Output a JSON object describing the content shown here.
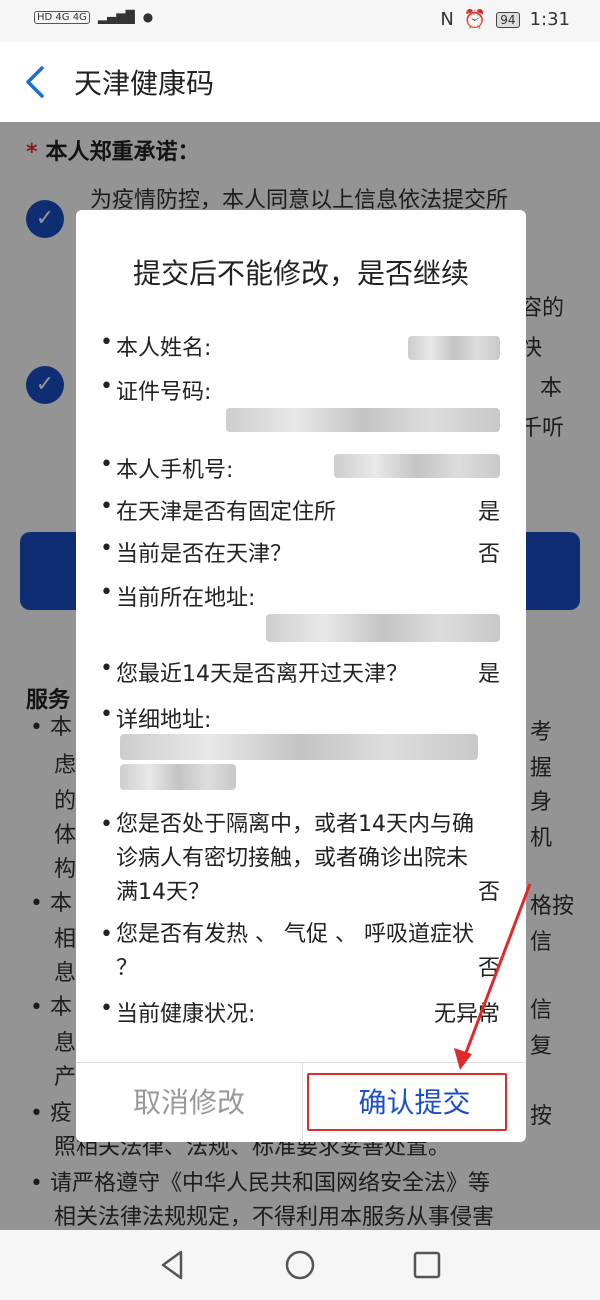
{
  "status_bar": {
    "left_indicators": "HD 4G 4G",
    "battery": "94",
    "time": "1:31"
  },
  "header": {
    "title": "天津健康码"
  },
  "background": {
    "pledge_title": "本人郑重承诺：",
    "pledge_item_1": "为疫情防控，本人同意以上信息依法提交所",
    "pledge_item_2_fragments": [
      "容的",
      "快",
      "本",
      "千听"
    ],
    "service_title": "服务",
    "service_lines": [
      "• 本",
      "虑",
      "的",
      "体",
      "构",
      "• 本",
      "相",
      "息",
      "• 本",
      "息",
      "产",
      "• 疫",
      "照相关法律、法规、标准要求妥善处置。",
      "• 请严格遵守《中华人民共和国网络安全法》等",
      "相关法律法规规定，不得利用本服务从事侵害"
    ],
    "right_fragments": [
      "考",
      "握",
      "身",
      "机",
      "格按",
      "信",
      "信",
      "复",
      "按"
    ]
  },
  "dialog": {
    "title": "提交后不能修改，是否继续",
    "rows": [
      {
        "label": "本人姓名:",
        "value": ""
      },
      {
        "label": "证件号码:",
        "value": ""
      },
      {
        "label": "本人手机号:",
        "value": ""
      },
      {
        "label": "在天津是否有固定住所",
        "value": "是"
      },
      {
        "label": "当前是否在天津？",
        "value": "否"
      },
      {
        "label": "当前所在地址:",
        "value": ""
      },
      {
        "label": "您最近14天是否离开过天津？",
        "value": "是"
      },
      {
        "label": "详细地址:",
        "value": ""
      },
      {
        "label": "您是否处于隔离中，或者14天内与确诊病人有密切接触，或者确诊出院未满14天？",
        "value": "否"
      },
      {
        "label": "您是否有发热 、 气促 、 呼吸道症状 ？",
        "value": "否"
      },
      {
        "label": "当前健康状况:",
        "value": "无异常"
      }
    ],
    "cancel_label": "取消修改",
    "confirm_label": "确认提交"
  },
  "colors": {
    "accent": "#1a4fc7",
    "highlight": "#e02a2a"
  },
  "icons": [
    "back-arrow-icon",
    "nfc-icon",
    "alarm-icon",
    "checkmark-icon",
    "nav-back-icon",
    "nav-home-icon",
    "nav-recent-icon"
  ]
}
